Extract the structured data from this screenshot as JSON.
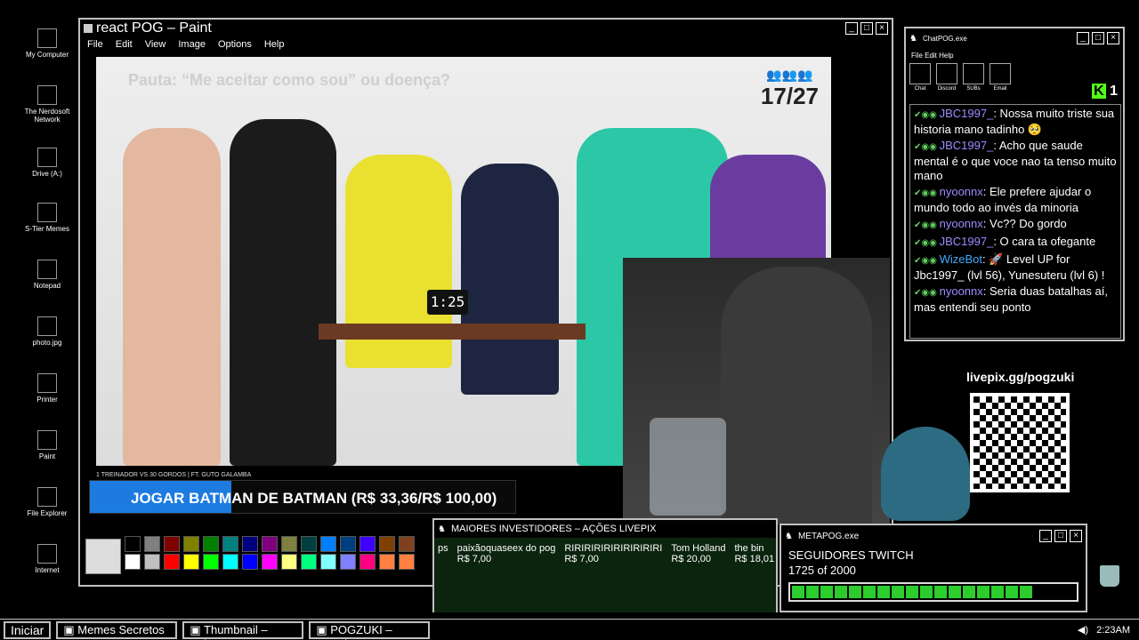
{
  "desktop_icons": [
    {
      "label": "My Computer",
      "icon": "computer-icon"
    },
    {
      "label": "The Nerdosoft Network",
      "icon": "network-icon"
    },
    {
      "label": "Drive (A:)",
      "icon": "floppy-drive-icon"
    },
    {
      "label": "S-Tier Memes",
      "icon": "folder-icon"
    },
    {
      "label": "Notepad",
      "icon": "notepad-icon"
    },
    {
      "label": "photo.jpg",
      "icon": "image-icon"
    },
    {
      "label": "Printer",
      "icon": "printer-icon"
    },
    {
      "label": "Paint",
      "icon": "paint-icon"
    },
    {
      "label": "File Explorer",
      "icon": "file-explorer-icon"
    },
    {
      "label": "Internet",
      "icon": "internet-icon"
    }
  ],
  "paint": {
    "title": "react POG – Paint",
    "menu": [
      "File",
      "Edit",
      "View",
      "Image",
      "Options",
      "Help"
    ],
    "pauta": "Pauta: “Me aceitar como sou” ou doença?",
    "counter": "17/27",
    "timer": "1:25",
    "caption": "1 TREINADOR VS 30 GORDOS | FT. GUTO GALAMBA",
    "palette_colors": [
      "#000000",
      "#7f7f7f",
      "#7f0000",
      "#7f7f00",
      "#007f00",
      "#007f7f",
      "#00007f",
      "#7f007f",
      "#7f7f3f",
      "#003f3f",
      "#007fff",
      "#003f7f",
      "#3f00ff",
      "#7f3f00",
      "#804020",
      "#ffffff",
      "#c0c0c0",
      "#ff0000",
      "#ffff00",
      "#00ff00",
      "#00ffff",
      "#0000ff",
      "#ff00ff",
      "#ffff80",
      "#00ff80",
      "#80ffff",
      "#8080ff",
      "#ff0080",
      "#ff8040",
      "#ff8040"
    ]
  },
  "goal": {
    "label": "JOGAR BATMAN DE BATMAN (R$ 33,36/R$ 100,00)",
    "progress": 0.3336
  },
  "chat": {
    "title": "ChatPOG.exe",
    "menu": "File Edit Help",
    "tools": [
      "Chat",
      "Discord",
      "SUBs",
      "Email"
    ],
    "kick_count": "1",
    "messages": [
      {
        "user": "JBC1997_",
        "text": ": Nossa muito triste sua historia mano tadinho 🥺",
        "bot": false
      },
      {
        "user": "JBC1997_",
        "text": ": Acho que saude mental é o que voce nao ta tenso muito mano",
        "bot": false
      },
      {
        "user": "nyoonnx",
        "text": ": Ele prefere ajudar o mundo todo ao invés da minoria",
        "bot": false
      },
      {
        "user": "nyoonnx",
        "text": ": Vc?? Do gordo",
        "bot": false
      },
      {
        "user": "JBC1997_",
        "text": ": O cara ta ofegante",
        "bot": false
      },
      {
        "user": "WizeBot",
        "text": ": 🚀 Level UP for Jbc1997_ (lvl 56), Yunesuteru (lvl 6) !",
        "bot": true
      },
      {
        "user": "nyoonnx",
        "text": ": Seria duas batalhas aí, mas entendi seu ponto",
        "bot": false
      }
    ]
  },
  "livepix": "livepix.gg/pogzuki",
  "investors": {
    "title": "MAIORES INVESTIDORES – AÇÕES LIVEPIX",
    "items": [
      {
        "name": "ps",
        "value": ""
      },
      {
        "name": "paixãoquaseex do pog",
        "value": "R$ 7,00"
      },
      {
        "name": "RIRIRIRIRIRIRIRIRIRI",
        "value": "R$ 7,00"
      },
      {
        "name": "Tom Holland",
        "value": "R$ 20,00"
      },
      {
        "name": "the bin",
        "value": "R$ 18,01"
      }
    ]
  },
  "meta": {
    "title": "METAPOG.exe",
    "label": "SEGUIDORES TWITCH",
    "count": "1725 of 2000",
    "progress": 0.8625
  },
  "taskbar": {
    "start": "Iniciar",
    "tasks": [
      "Memes Secretos",
      "Thumbnail – Paint",
      "POGZUKI – Google"
    ],
    "time": "2:23AM"
  }
}
